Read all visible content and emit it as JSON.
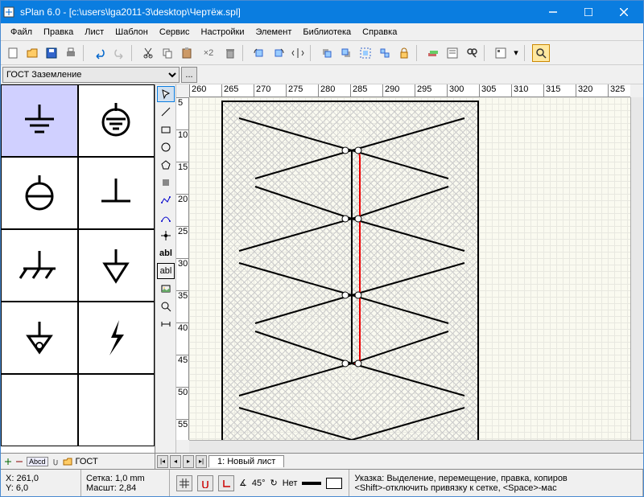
{
  "title": "sPlan 6.0 - [c:\\users\\lga2011-3\\desktop\\Чертёж.spl]",
  "menu": [
    "Файл",
    "Правка",
    "Лист",
    "Шаблон",
    "Сервис",
    "Настройки",
    "Элемент",
    "Библиотека",
    "Справка"
  ],
  "library": {
    "selected": "ГОСТ Заземление",
    "footer": "ГОСТ"
  },
  "ruler_h": [
    "260",
    "265",
    "270",
    "275",
    "280",
    "285",
    "290",
    "295",
    "300",
    "305",
    "310",
    "315",
    "320",
    "325"
  ],
  "ruler_v": [
    "5",
    "10",
    "15",
    "20",
    "25",
    "30",
    "35",
    "40",
    "45",
    "50",
    "55"
  ],
  "tab": {
    "label": "1: Новый лист"
  },
  "status": {
    "x": "X: 261,0",
    "y": "Y: 6,0",
    "grid": "Сетка:  1,0 mm",
    "scale": "Масшт:  2,84",
    "angle": "45°",
    "snap": "Нет",
    "hint": "Указка: Выделение, перемещение, правка, копиров",
    "hint2": "<Shift>-отключить привязку к сетке, <Space>-мас"
  },
  "x2_label": "×2",
  "abl_label": "abl",
  "chart_data": {
    "type": "schematic",
    "application": "sPlan 6.0",
    "note": "electrical circuit drawing canvas, not a data chart"
  }
}
